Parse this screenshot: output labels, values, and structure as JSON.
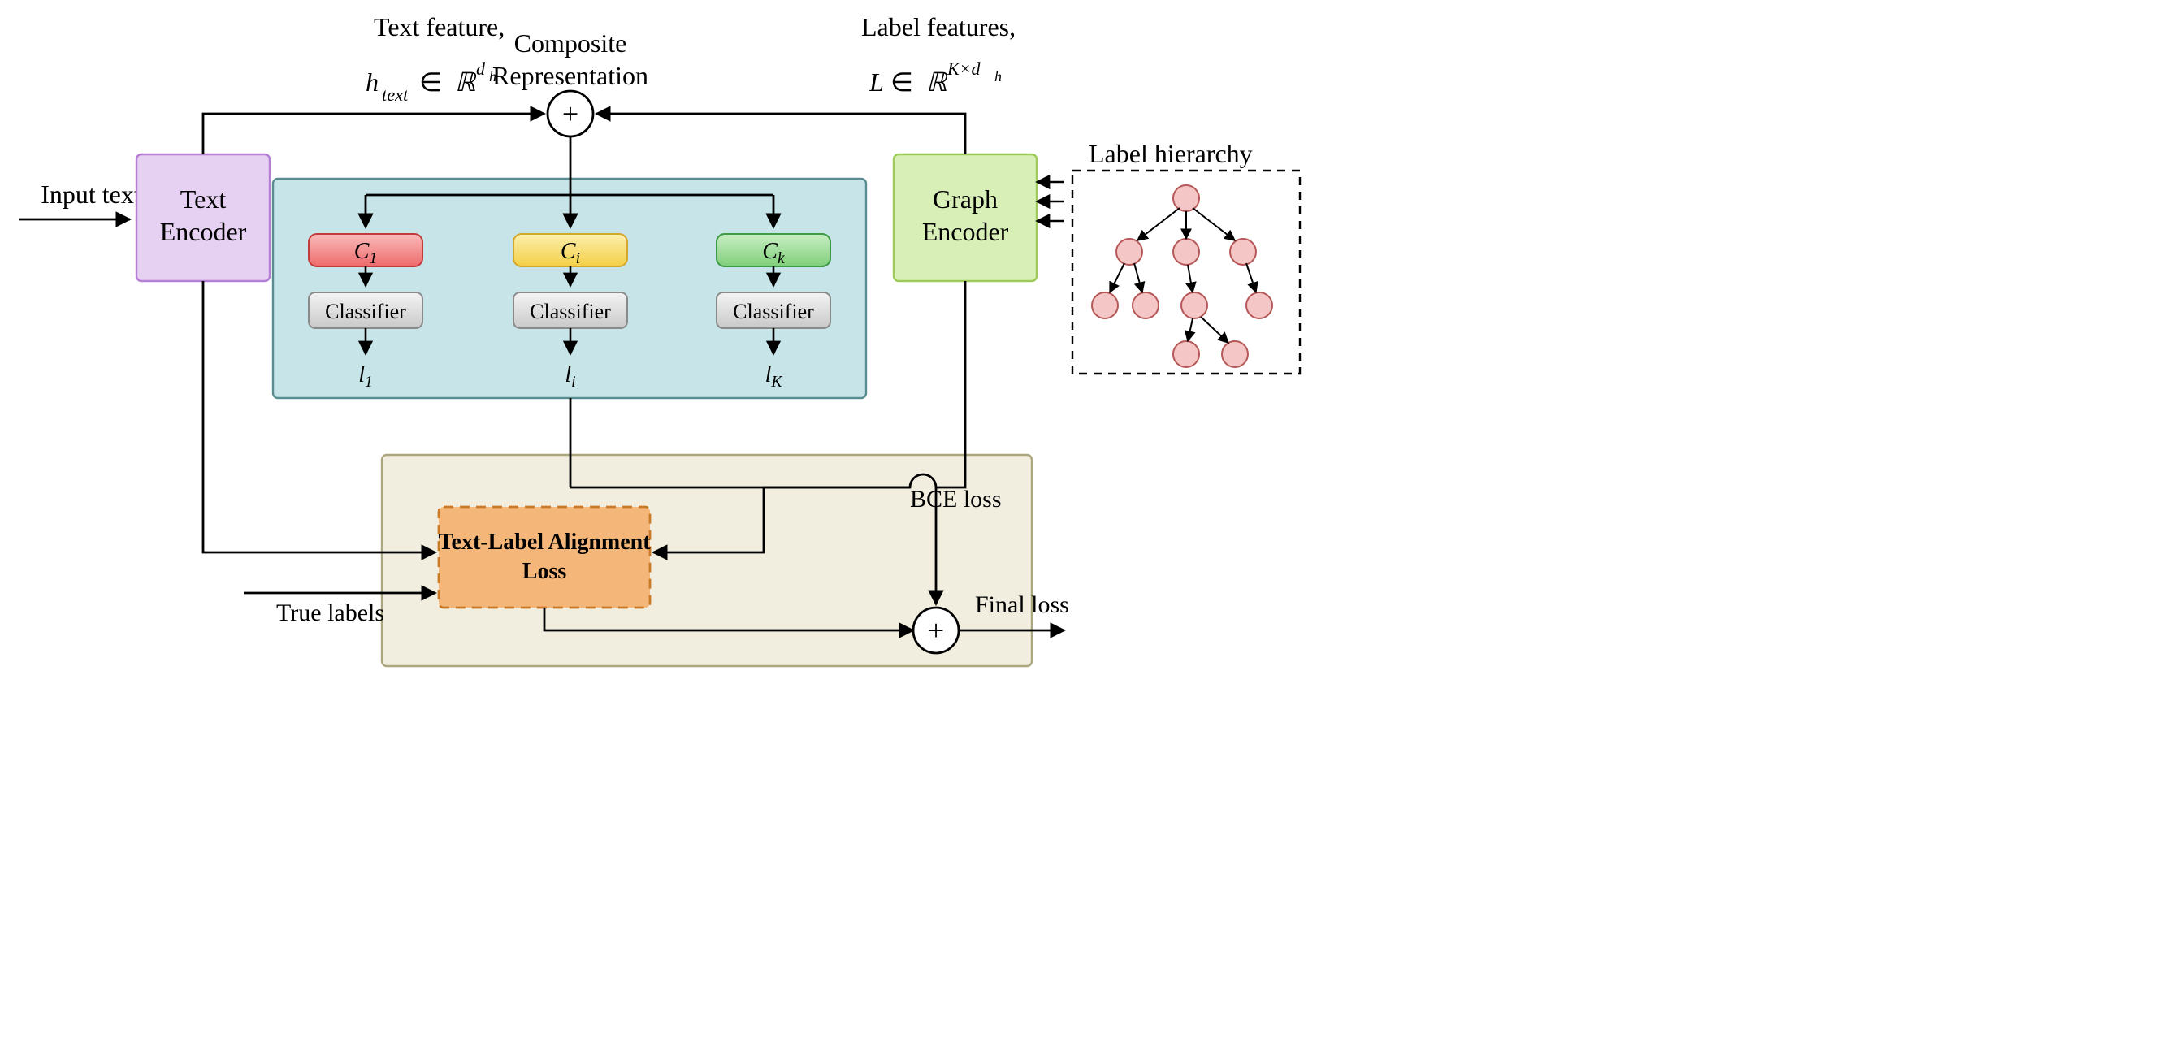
{
  "labels": {
    "input_text": "Input text",
    "text_encoder": "Text\nEncoder",
    "text_feature_title": "Text feature,",
    "text_feature_formula_plain": "h_text ∈ R^(d_h)",
    "composite_repr_line1": "Composite",
    "composite_repr_line2": "Representation",
    "label_features_title": "Label features,",
    "label_features_formula_plain": "L ∈ R^(K × d_h)",
    "graph_encoder": "Graph\nEncoder",
    "label_hierarchy": "Label hierarchy",
    "classifier": "Classifier",
    "C1": "C₁",
    "Ci": "Cᵢ",
    "Ck": "Cₖ",
    "l1": "l₁",
    "li": "lᵢ",
    "lK": "l_K",
    "tla_loss_line1": "Text-Label Alignment",
    "tla_loss_line2": "Loss",
    "true_labels": "True labels",
    "bce_loss": "BCE loss",
    "final_loss": "Final loss"
  },
  "colors": {
    "text_encoder_fill": "#e6d1f2",
    "text_encoder_stroke": "#b57fd6",
    "graph_encoder_fill": "#d8f0b8",
    "graph_encoder_stroke": "#9ecb58",
    "classifier_panel_fill": "#c7e5e8",
    "classifier_panel_stroke": "#5a8d92",
    "c1_fill": "#f48f8f",
    "c1_stroke": "#c23a3a",
    "ci_fill": "#f9e27e",
    "ci_stroke": "#d4a72a",
    "ck_fill": "#a4e0a0",
    "ck_stroke": "#3d9a45",
    "classifier_fill": "#e3e3e3",
    "classifier_stroke": "#8a8a8a",
    "loss_panel_fill": "#f1eedf",
    "loss_panel_stroke": "#aba67e",
    "tla_fill": "#f5b779",
    "tla_stroke": "#c97a28",
    "tree_node_fill": "#f5c6c6",
    "tree_node_stroke": "#b55858"
  },
  "diagram": {
    "nodes": [
      {
        "id": "input-text",
        "data_name": "input-text-label",
        "interactable": false
      },
      {
        "id": "text-encoder",
        "data_name": "text-encoder-box",
        "interactable": false
      },
      {
        "id": "composite",
        "data_name": "composite-representation-node",
        "interactable": false
      },
      {
        "id": "graph-encoder",
        "data_name": "graph-encoder-box",
        "interactable": false
      },
      {
        "id": "label-hierarchy",
        "data_name": "label-hierarchy-box",
        "interactable": false
      },
      {
        "id": "classifier-panel",
        "data_name": "classifier-panel",
        "interactable": false
      },
      {
        "id": "loss-panel",
        "data_name": "loss-panel",
        "interactable": false
      },
      {
        "id": "tla-loss",
        "data_name": "text-label-alignment-loss-box",
        "interactable": false
      },
      {
        "id": "final-loss",
        "data_name": "final-loss-node",
        "interactable": false
      }
    ]
  }
}
